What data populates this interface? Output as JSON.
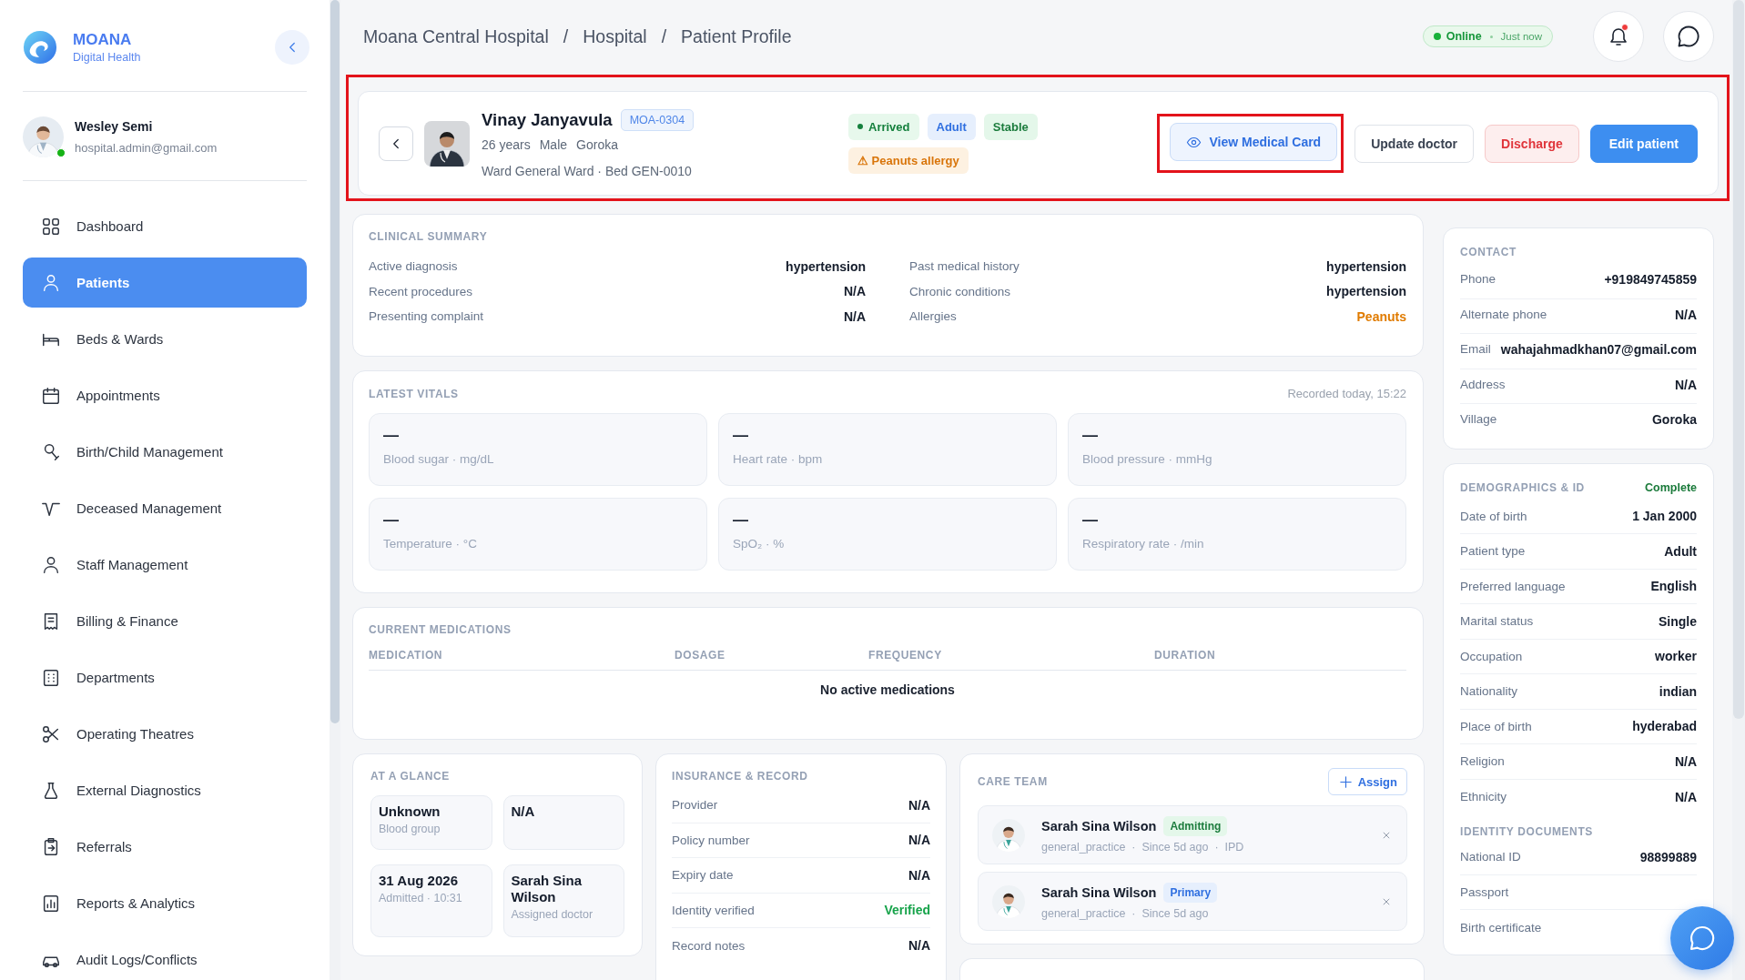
{
  "brand": {
    "name": "MOANA",
    "tagline": "Digital Health"
  },
  "user": {
    "name": "Wesley Semi",
    "email": "hospital.admin@gmail.com",
    "online": true
  },
  "nav": [
    {
      "label": "Dashboard",
      "selected": false
    },
    {
      "label": "Patients",
      "selected": true
    },
    {
      "label": "Beds & Wards",
      "selected": false
    },
    {
      "label": "Appointments",
      "selected": false
    },
    {
      "label": "Birth/Child Management",
      "selected": false
    },
    {
      "label": "Deceased Management",
      "selected": false
    },
    {
      "label": "Staff Management",
      "selected": false
    },
    {
      "label": "Billing & Finance",
      "selected": false
    },
    {
      "label": "Departments",
      "selected": false
    },
    {
      "label": "Operating Theatres",
      "selected": false
    },
    {
      "label": "External Diagnostics",
      "selected": false
    },
    {
      "label": "Referrals",
      "selected": false
    },
    {
      "label": "Reports & Analytics",
      "selected": false
    },
    {
      "label": "Audit Logs/Conflicts",
      "selected": false
    }
  ],
  "breadcrumb": {
    "separator": "/",
    "items": [
      "Moana Central Hospital",
      "Hospital",
      "Patient Profile"
    ]
  },
  "status": {
    "label": "Online",
    "time": "Just now"
  },
  "notifications": {
    "unread": true
  },
  "patient": {
    "highlighted": true,
    "name": "Vinay Janyavula",
    "id": "MOA-0304",
    "details": [
      "26 years",
      "Male",
      "Goroka"
    ],
    "location": "Ward General Ward · Bed GEN-0010",
    "tags": [
      {
        "label": "Arrived",
        "kind": "status"
      },
      {
        "label": "Adult",
        "kind": "info"
      },
      {
        "label": "Stable",
        "kind": "success"
      }
    ],
    "alerts": [
      {
        "label": "⚠ Peanuts allergy",
        "kind": "warning"
      }
    ]
  },
  "actions": [
    {
      "label": "View Medical Card",
      "kind": "outline",
      "highlighted": true
    },
    {
      "label": "Update doctor",
      "kind": "plain",
      "highlighted": false
    },
    {
      "label": "Discharge",
      "kind": "danger",
      "highlighted": false
    },
    {
      "label": "Edit patient",
      "kind": "primary",
      "highlighted": false
    }
  ],
  "clinical_summary": {
    "title": "CLINICAL SUMMARY",
    "rows": [
      {
        "label": "Active diagnosis",
        "value": "hypertension"
      },
      {
        "label": "Past medical history",
        "value": "hypertension"
      },
      {
        "label": "Recent procedures",
        "value": "N/A"
      },
      {
        "label": "Chronic conditions",
        "value": "hypertension"
      },
      {
        "label": "Presenting complaint",
        "value": "N/A"
      },
      {
        "label": "Allergies",
        "value": "Peanuts",
        "kind": "alert"
      }
    ]
  },
  "vitals": {
    "title": "LATEST VITALS",
    "recorded": "Recorded today, 15:22",
    "items": [
      {
        "value": "—",
        "label": "Blood sugar · mg/dL"
      },
      {
        "value": "—",
        "label": "Heart rate · bpm"
      },
      {
        "value": "—",
        "label": "Blood pressure · mmHg"
      },
      {
        "value": "—",
        "label": "Temperature · °C"
      },
      {
        "value": "—",
        "label": "SpO₂ · %"
      },
      {
        "value": "—",
        "label": "Respiratory rate · /min"
      }
    ]
  },
  "medications": {
    "title": "CURRENT MEDICATIONS",
    "columns": [
      "MEDICATION",
      "DOSAGE",
      "FREQUENCY",
      "DURATION"
    ],
    "empty": "No active medications"
  },
  "at_a_glance": {
    "title": "AT A GLANCE",
    "items": [
      {
        "value": "Unknown",
        "label": "Blood group"
      },
      {
        "value": "N/A"
      },
      {
        "value": "31 Aug 2026",
        "label": "Admitted · 10:31"
      },
      {
        "value": "Sarah Sina Wilson",
        "label": "Assigned doctor"
      }
    ]
  },
  "insurance": {
    "title": "INSURANCE & RECORD",
    "rows": [
      {
        "label": "Provider",
        "value": "N/A"
      },
      {
        "label": "Policy number",
        "value": "N/A"
      },
      {
        "label": "Expiry date",
        "value": "N/A"
      },
      {
        "label": "Identity verified",
        "value": "Verified",
        "kind": "success"
      },
      {
        "label": "Record notes",
        "value": "N/A"
      }
    ]
  },
  "care_team": {
    "title": "CARE TEAM",
    "assign": "Assign",
    "members": [
      {
        "name": "Sarah Sina Wilson",
        "role": "Admitting",
        "kind": "success",
        "meta": "general_practice  ·  Since 5d ago  ·  IPD"
      },
      {
        "name": "Sarah Sina Wilson",
        "role": "Primary",
        "kind": "info",
        "meta": "general_practice  ·  Since 5d ago"
      }
    ]
  },
  "contact": {
    "title": "CONTACT",
    "rows": [
      {
        "label": "Phone",
        "value": "+919849745859"
      },
      {
        "label": "Alternate phone",
        "value": "N/A"
      },
      {
        "label": "Email",
        "value": "wahajahmadkhan07@gmail.com"
      },
      {
        "label": "Address",
        "value": "N/A"
      },
      {
        "label": "Village",
        "value": "Goroka"
      }
    ]
  },
  "demographics": {
    "title": "DEMOGRAPHICS & ID",
    "status": "Complete",
    "rows": [
      {
        "label": "Date of birth",
        "value": "1 Jan 2000"
      },
      {
        "label": "Patient type",
        "value": "Adult"
      },
      {
        "label": "Preferred language",
        "value": "English"
      },
      {
        "label": "Marital status",
        "value": "Single"
      },
      {
        "label": "Occupation",
        "value": "worker"
      },
      {
        "label": "Nationality",
        "value": "indian"
      },
      {
        "label": "Place of birth",
        "value": "hyderabad"
      },
      {
        "label": "Religion",
        "value": "N/A"
      },
      {
        "label": "Ethnicity",
        "value": "N/A"
      }
    ],
    "documents_title": "IDENTITY DOCUMENTS",
    "documents": [
      {
        "label": "National ID",
        "value": "98899889"
      },
      {
        "label": "Passport"
      },
      {
        "label": "Birth certificate"
      }
    ]
  }
}
